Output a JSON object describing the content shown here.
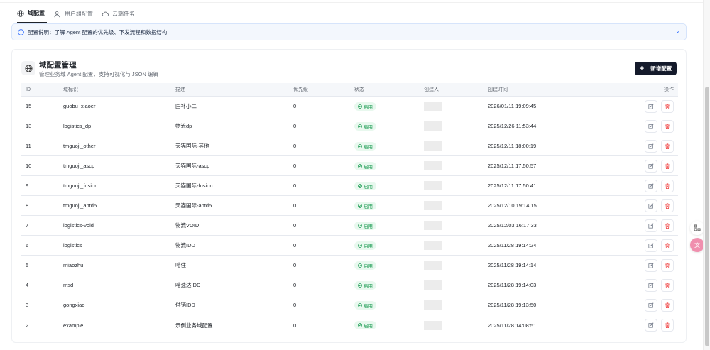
{
  "tabs": [
    {
      "label": "域配置",
      "icon": "globe-icon"
    },
    {
      "label": "用户组配置",
      "icon": "users-icon"
    },
    {
      "label": "云端任务",
      "icon": "cloud-icon"
    }
  ],
  "banner": {
    "text": "配置说明：了解 Agent 配置的优先级、下发流程和数据结构"
  },
  "card": {
    "title": "域配置管理",
    "subtitle": "管理业务域 Agent 配置，支持可视化与 JSON 编辑",
    "add_label": "新增配置"
  },
  "table": {
    "headers": {
      "id": "ID",
      "key": "域标识",
      "desc": "描述",
      "priority": "优先级",
      "status": "状态",
      "creator": "创建人",
      "time": "创建时间",
      "ops": "操作"
    },
    "rows": [
      {
        "id": "15",
        "key": "guobu_xiaoer",
        "desc": "国补小二",
        "priority": "0",
        "status": "启用",
        "time": "2026/01/11 19:09:45"
      },
      {
        "id": "13",
        "key": "logistics_dp",
        "desc": "物流dp",
        "priority": "0",
        "status": "启用",
        "time": "2025/12/26 11:53:44"
      },
      {
        "id": "11",
        "key": "tmguoji_other",
        "desc": "天猫国际-其他",
        "priority": "0",
        "status": "启用",
        "time": "2025/12/11 18:00:19"
      },
      {
        "id": "10",
        "key": "tmguoji_ascp",
        "desc": "天猫国际-ascp",
        "priority": "0",
        "status": "启用",
        "time": "2025/12/11 17:50:57"
      },
      {
        "id": "9",
        "key": "tmguoji_fusion",
        "desc": "天猫国际-fusion",
        "priority": "0",
        "status": "启用",
        "time": "2025/12/11 17:50:41"
      },
      {
        "id": "8",
        "key": "tmguoji_antd5",
        "desc": "天猫国际-antd5",
        "priority": "0",
        "status": "启用",
        "time": "2025/12/10 19:14:15"
      },
      {
        "id": "7",
        "key": "logistics-void",
        "desc": "物流VOID",
        "priority": "0",
        "status": "启用",
        "time": "2025/12/03 16:17:33"
      },
      {
        "id": "6",
        "key": "logistics",
        "desc": "物流IDD",
        "priority": "0",
        "status": "启用",
        "time": "2025/11/28 19:14:24"
      },
      {
        "id": "5",
        "key": "miaozhu",
        "desc": "喵住",
        "priority": "0",
        "status": "启用",
        "time": "2025/11/28 19:14:14"
      },
      {
        "id": "4",
        "key": "msd",
        "desc": "喵速达IDD",
        "priority": "0",
        "status": "启用",
        "time": "2025/11/28 19:14:03"
      },
      {
        "id": "3",
        "key": "gongxiao",
        "desc": "供销IDD",
        "priority": "0",
        "status": "启用",
        "time": "2025/11/28 19:13:50"
      },
      {
        "id": "2",
        "key": "example",
        "desc": "示例业务域配置",
        "priority": "0",
        "status": "启用",
        "time": "2025/11/28 14:08:51"
      }
    ]
  },
  "colors": {
    "primary_button": "#141a2b",
    "status_green": "#1f9d55",
    "delete_red": "#f04848",
    "banner_bg": "#f3f7fd"
  }
}
